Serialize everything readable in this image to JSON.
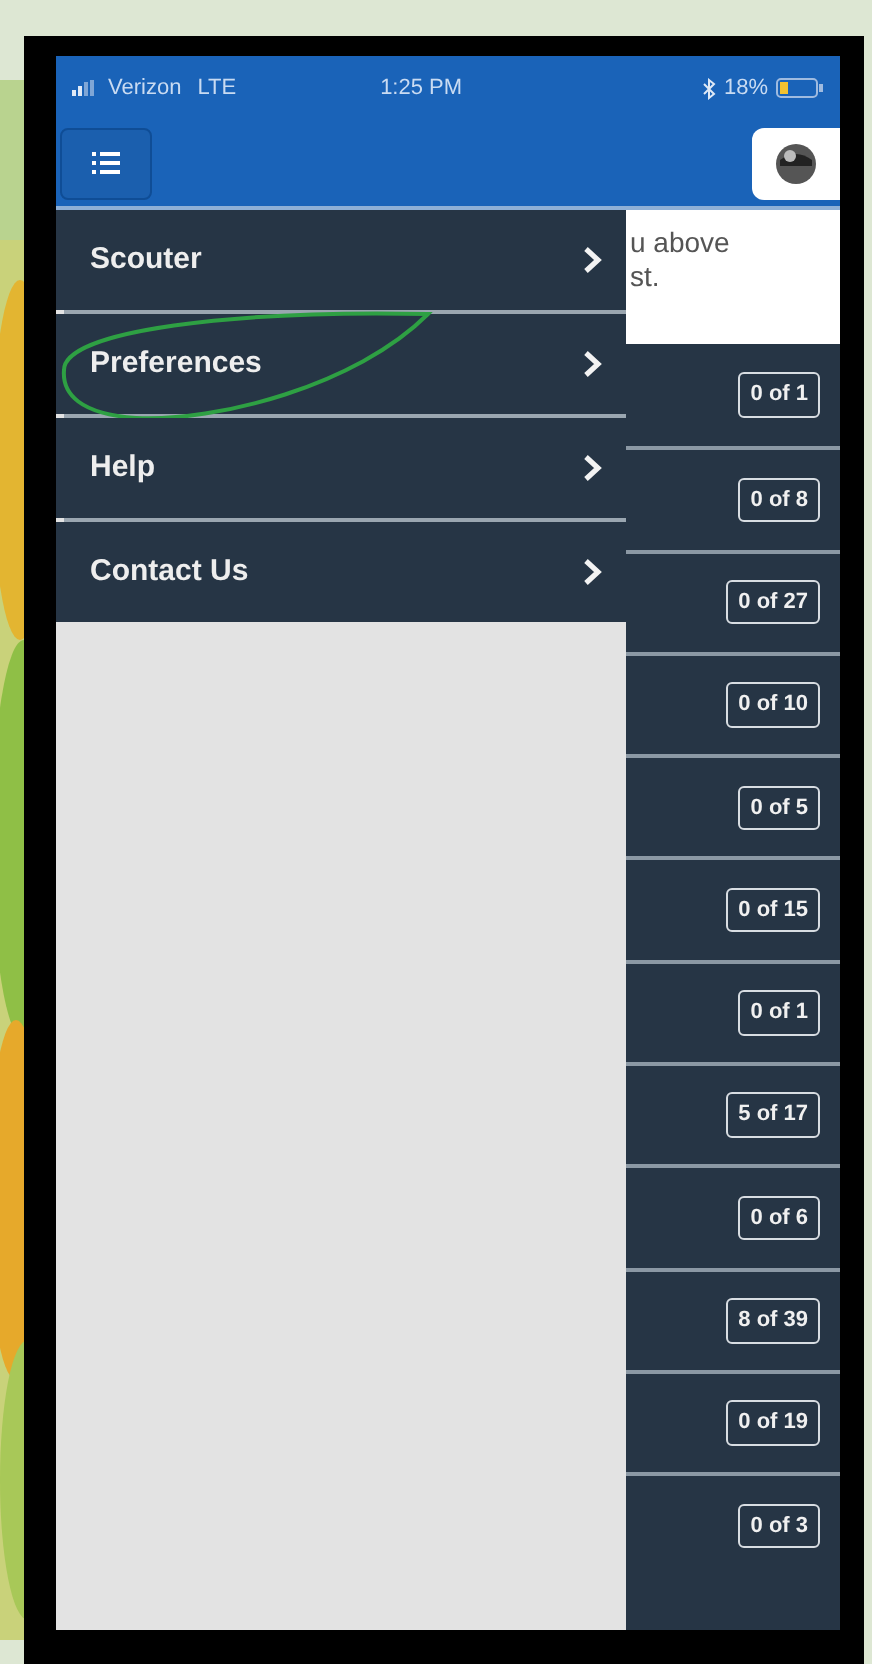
{
  "status_bar": {
    "carrier": "Verizon",
    "network": "LTE",
    "time": "1:25 PM",
    "battery": "18%"
  },
  "drawer": {
    "items": [
      {
        "label": "Scouter"
      },
      {
        "label": "Preferences",
        "circled": true
      },
      {
        "label": "Help"
      },
      {
        "label": "Contact Us"
      }
    ]
  },
  "note": {
    "lines": [
      "u above",
      "st."
    ]
  },
  "rows": [
    {
      "badge": "0 of 1"
    },
    {
      "badge": "0 of 8"
    },
    {
      "badge": "0 of 27"
    },
    {
      "badge": "0 of 10"
    },
    {
      "badge": "0 of 5"
    },
    {
      "badge": "0 of 15"
    },
    {
      "badge": "0 of 1"
    },
    {
      "badge": "5 of 17"
    },
    {
      "badge": "0 of 6"
    },
    {
      "badge": "8 of 39"
    },
    {
      "badge": "0 of 19"
    },
    {
      "badge": "0 of 3"
    }
  ]
}
